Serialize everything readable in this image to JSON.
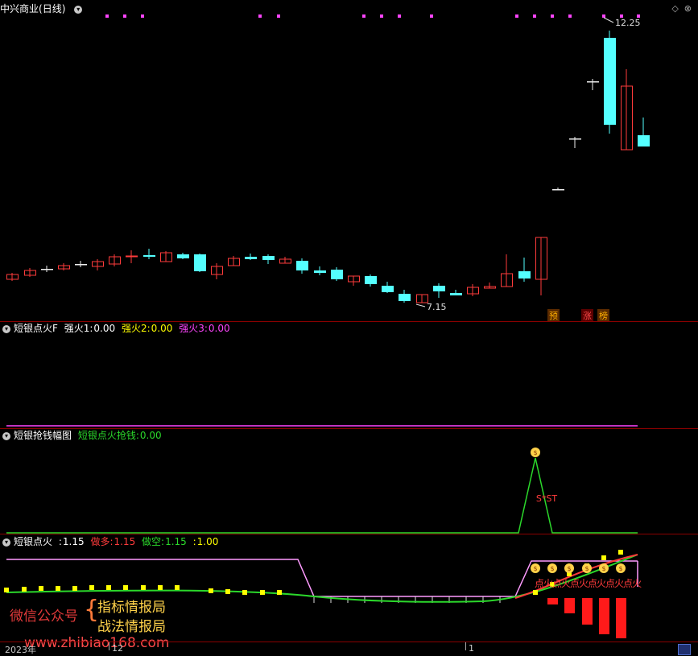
{
  "title": {
    "stock": "中兴商业",
    "period": "(日线)"
  },
  "main_chart": {
    "high_label": "12.25",
    "low_label": "7.15",
    "tags": [
      "预",
      "涨",
      "榜"
    ]
  },
  "panel1": {
    "name": "短银点火F",
    "v1_label": "强火1:",
    "v1": "0.00",
    "v2_label": "强火2:",
    "v2": "0.00",
    "v3_label": "强火3:",
    "v3": "0.00"
  },
  "panel2": {
    "name": "短银抢钱幅图",
    "v1_label": "短银点火抢钱:",
    "v1": "0.00",
    "marker": "S*ST"
  },
  "panel3": {
    "name": "短银点火",
    "v0_label": ":",
    "v0": "1.15",
    "v1_label": "做多:",
    "v1": "1.15",
    "v2_label": "做空:",
    "v2": "1.15",
    "v3_label": ":",
    "v3": "1.00",
    "fire_label": "点火"
  },
  "watermark": {
    "line1": "微信公众号",
    "line2": "指标情报局",
    "line3": "战法情报局",
    "url": "www.zhibiao168.com"
  },
  "axis": {
    "year": "2023年",
    "m1": "12",
    "m2": "1"
  },
  "colors": {
    "up": "#ff3b3b",
    "down": "#54ffff",
    "magenta": "#ff44ff",
    "green": "#2bd82b",
    "yellow": "#ffff00"
  }
}
